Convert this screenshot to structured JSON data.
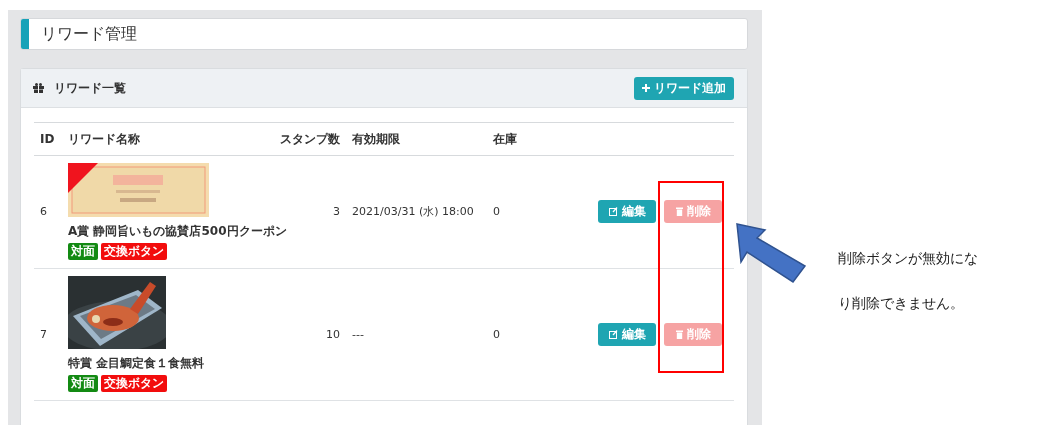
{
  "page_title": "リワード管理",
  "card": {
    "title": "リワード一覧",
    "add_button": "リワード追加"
  },
  "table": {
    "columns": [
      "ID",
      "リワード名称",
      "スタンプ数",
      "有効期限",
      "在庫"
    ],
    "rows": [
      {
        "id": "6",
        "image": {
          "kind": "coupon"
        },
        "name": "A賞 静岡旨いもの協賛店500円クーポン",
        "tags": [
          {
            "label": "対面",
            "color": "#138a13"
          },
          {
            "label": "交換ボタン",
            "color": "#f20d0d"
          }
        ],
        "stamps": "3",
        "expiry": "2021/03/31 (水) 18:00",
        "stock": "0",
        "edit": {
          "label": "編集",
          "disabled": false
        },
        "delete": {
          "label": "削除",
          "disabled": true
        }
      },
      {
        "id": "7",
        "name": "特賞 金目鯛定食１食無料",
        "tags": [
          {
            "label": "対面",
            "color": "#138a13"
          },
          {
            "label": "交換ボタン",
            "color": "#f20d0d"
          }
        ],
        "stamps": "10",
        "expiry": "---",
        "stock": "0",
        "edit": {
          "label": "編集",
          "disabled": false
        },
        "delete": {
          "label": "削除",
          "disabled": true
        }
      }
    ]
  },
  "annotation": {
    "lines": [
      "削除ボタンが無効にな",
      "り削除できません。"
    ]
  }
}
